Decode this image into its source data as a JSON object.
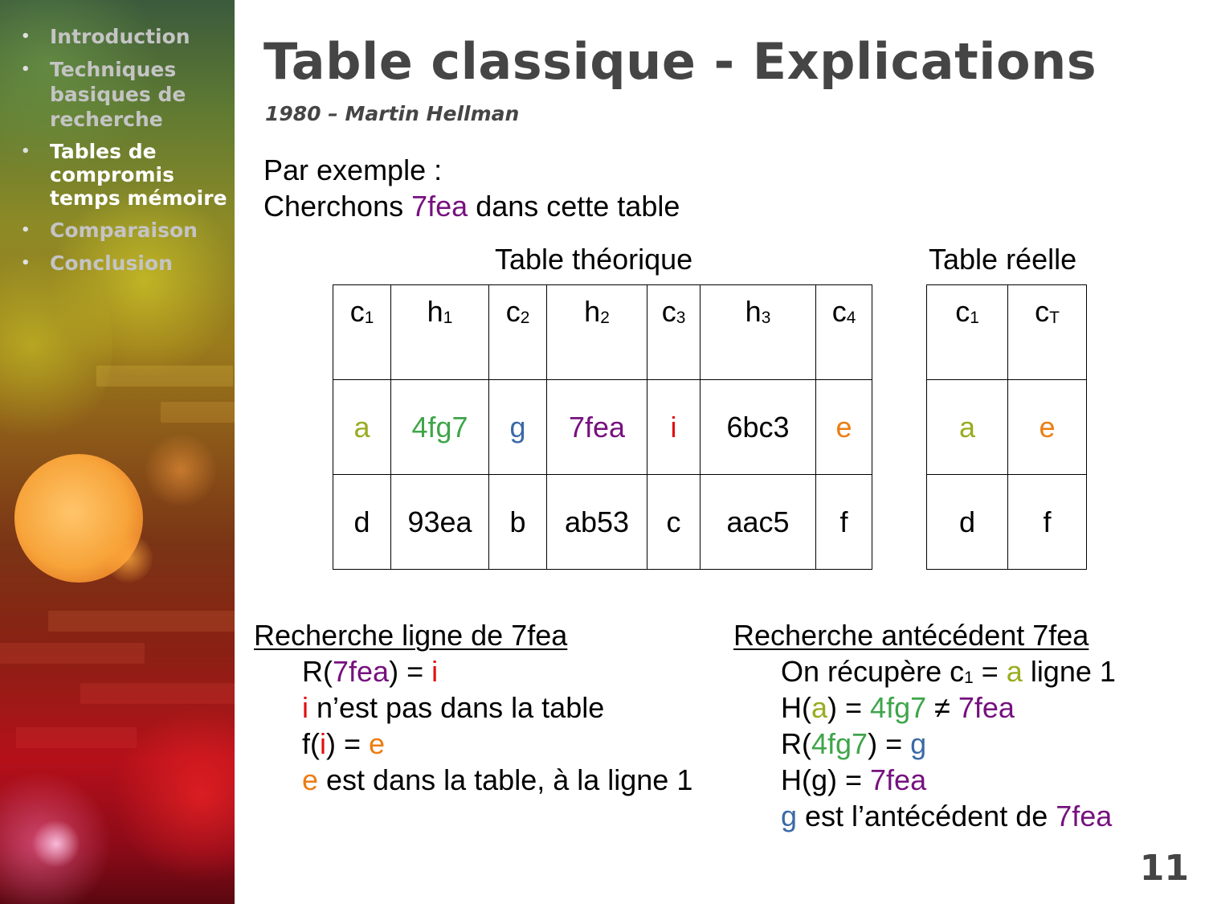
{
  "sidebar": {
    "items": [
      {
        "label": "Introduction"
      },
      {
        "label": "Techniques basiques de recherche"
      },
      {
        "label": "Tables de compromis temps mémoire"
      },
      {
        "label": "Comparaison"
      },
      {
        "label": "Conclusion"
      }
    ],
    "active_index": 2
  },
  "slide": {
    "title": "Table classique - Explications",
    "subtitle": "1980 – Martin Hellman",
    "intro_line1": "Par exemple :",
    "intro_line2_pre": "Cherchons ",
    "intro_line2_key": "7fea",
    "intro_line2_post": " dans cette table",
    "page_number": "11"
  },
  "theoretical_table": {
    "caption": "Table théorique",
    "headers": [
      {
        "base": "c",
        "sub": "1"
      },
      {
        "base": "h",
        "sub": "1"
      },
      {
        "base": "c",
        "sub": "2"
      },
      {
        "base": "h",
        "sub": "2"
      },
      {
        "base": "c",
        "sub": "3"
      },
      {
        "base": "h",
        "sub": "3"
      },
      {
        "base": "c",
        "sub": "4"
      }
    ],
    "rows": [
      [
        "a",
        "4fg7",
        "g",
        "7fea",
        "i",
        "6bc3",
        "e"
      ],
      [
        "d",
        "93ea",
        "b",
        "ab53",
        "c",
        "aac5",
        "f"
      ]
    ]
  },
  "real_table": {
    "caption": "Table réelle",
    "headers": [
      {
        "base": "c",
        "sub": "1"
      },
      {
        "base": "c",
        "sub": "T"
      }
    ],
    "rows": [
      [
        "a",
        "e"
      ],
      [
        "d",
        "f"
      ]
    ]
  },
  "search_line": {
    "heading": "Recherche ligne de 7fea",
    "l1_a": "R(",
    "l1_b": "7fea",
    "l1_c": ") = ",
    "l1_d": "i",
    "l2_a": "i",
    "l2_b": " n’est pas dans la table",
    "l3_a": "f(",
    "l3_b": "i",
    "l3_c": ") = ",
    "l3_d": "e",
    "l4_a": "e",
    "l4_b": " est dans la table, à la ligne 1"
  },
  "search_antecedent": {
    "heading": "Recherche antécédent 7fea",
    "l1_a": "On récupère c",
    "l1_sub": "1",
    "l1_b": " = ",
    "l1_c": "a",
    "l1_d": " ligne 1",
    "l2_a": "H(",
    "l2_b": "a",
    "l2_c": ") = ",
    "l2_d": "4fg7",
    "l2_e": " ≠ ",
    "l2_f": "7fea",
    "l3_a": "R(",
    "l3_b": "4fg7",
    "l3_c": ") = ",
    "l3_d": "g",
    "l4_a": "H(g) = ",
    "l4_b": "7fea",
    "l5_a": "g",
    "l5_b": " est l’antécédent de ",
    "l5_c": "7fea"
  },
  "colors": {
    "a": "#9aac20",
    "hash_4fg7": "#3fa54a",
    "g": "#3a69a6",
    "key_7fea": "#76117f",
    "i": "#e01010",
    "e": "#ec7d12",
    "title": "#454545"
  }
}
